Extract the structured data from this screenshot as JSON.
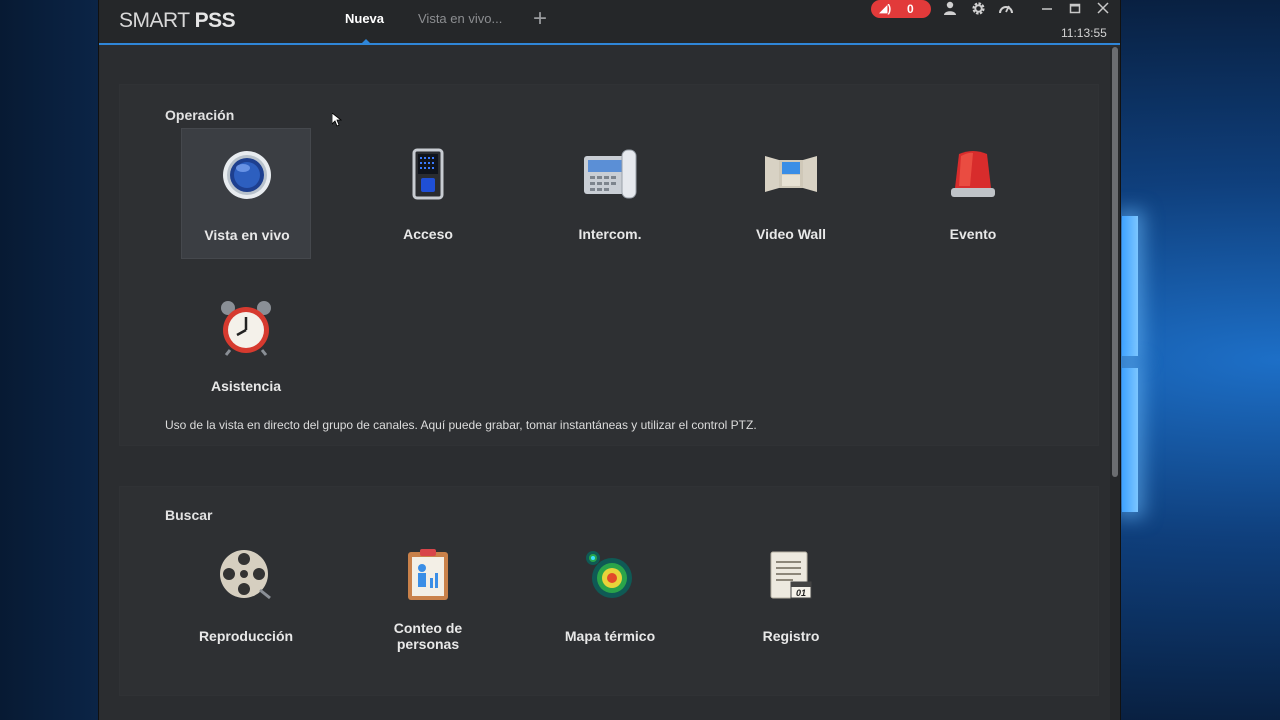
{
  "app": {
    "logo_light": "SMART",
    "logo_bold": "PSS",
    "tabs": [
      {
        "label": "Nueva",
        "active": true
      },
      {
        "label": "Vista en vivo...",
        "active": false
      }
    ],
    "alarm_count": "0",
    "clock": "11:13:55",
    "accent": "#2f86d8",
    "alert_color": "#e23a3a"
  },
  "operacion": {
    "title": "Operación",
    "items": [
      {
        "label": "Vista en vivo",
        "icon": "live-view-camera-icon"
      },
      {
        "label": "Acceso",
        "icon": "access-terminal-icon"
      },
      {
        "label": "Intercom.",
        "icon": "intercom-phone-icon"
      },
      {
        "label": "Video Wall",
        "icon": "video-wall-icon"
      },
      {
        "label": "Evento",
        "icon": "alarm-siren-icon"
      },
      {
        "label": "Asistencia",
        "icon": "alarm-clock-icon"
      }
    ],
    "description": "Uso de la vista en directo del grupo de canales. Aquí puede grabar, tomar instantáneas y utilizar el control PTZ."
  },
  "buscar": {
    "title": "Buscar",
    "items": [
      {
        "label": "Reproducción",
        "icon": "film-reel-icon"
      },
      {
        "label_line1": "Conteo de",
        "label_line2": "personas",
        "icon": "people-count-clipboard-icon"
      },
      {
        "label": "Mapa térmico",
        "icon": "heat-map-icon"
      },
      {
        "label": "Registro",
        "icon": "log-calendar-icon"
      }
    ]
  }
}
